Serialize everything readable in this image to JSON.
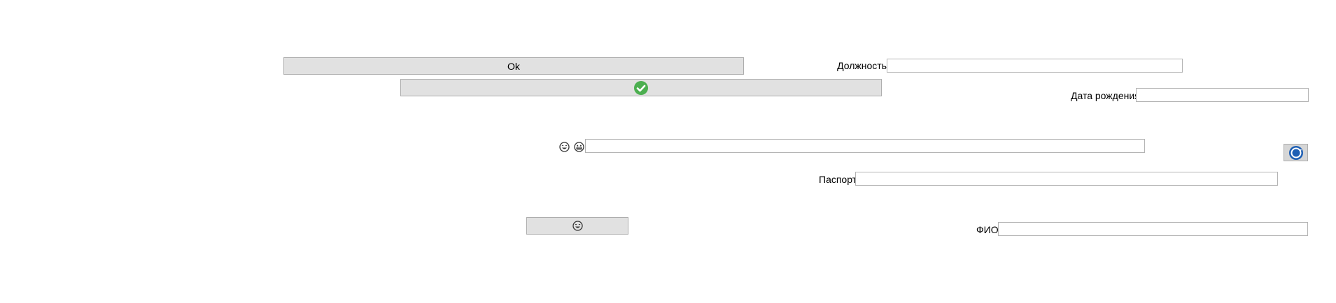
{
  "buttons": {
    "ok_label": "Ok",
    "confirm_icon": "check-circle-icon",
    "emoji_icon": "laughing-face-icon",
    "refresh_icon": "refresh-icon"
  },
  "labels": {
    "position": "Должность",
    "birth_date": "Дата рождения",
    "passport": "Паспорт",
    "full_name": "ФИО"
  },
  "fields": {
    "position_value": "",
    "birth_date_value": "",
    "emoji_field_value": "",
    "passport_value": "",
    "full_name_value": ""
  },
  "icons": {
    "face_left": "laughing-face-icon",
    "face_right": "grinning-face-icon"
  },
  "colors": {
    "check_green": "#4caf50",
    "refresh_blue": "#1e5fb4",
    "button_bg": "#e1e1e1",
    "button_border": "#adadad"
  }
}
